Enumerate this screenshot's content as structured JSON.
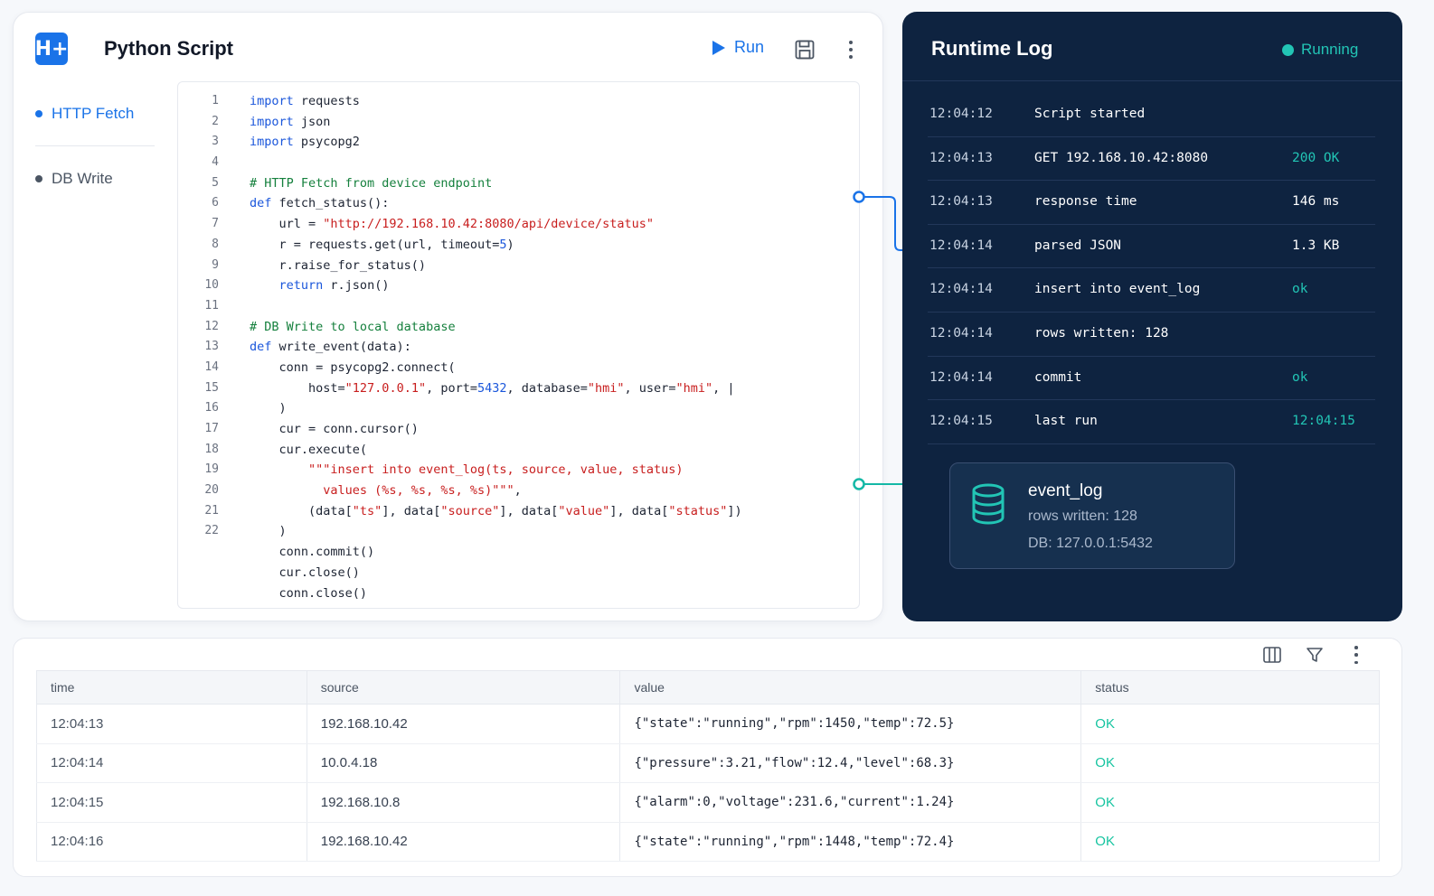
{
  "editor": {
    "logo_text": "H+",
    "title": "Python Script",
    "run_label": "Run",
    "save_icon": "save-icon",
    "more_icon": "more-vertical-icon",
    "nav": [
      {
        "label": "HTTP Fetch",
        "active": true
      },
      {
        "label": "DB Write",
        "active": false
      }
    ],
    "code_lines": [
      {
        "n": "1",
        "html": "<span class='kw'>import</span> requests"
      },
      {
        "n": "2",
        "html": "<span class='kw'>import</span> json"
      },
      {
        "n": "3",
        "html": "<span class='kw'>import</span> psycopg2"
      },
      {
        "n": "4",
        "html": ""
      },
      {
        "n": "5",
        "html": "<span class='cm'># HTTP Fetch from device endpoint</span>"
      },
      {
        "n": "6",
        "html": "<span class='kw'>def</span> fetch_status():"
      },
      {
        "n": "7",
        "html": "    url = <span class='st'>\"http://192.168.10.42:8080/api/device/status\"</span>"
      },
      {
        "n": "8",
        "html": "    r = requests.get(url, timeout=<span class='nm'>5</span>)"
      },
      {
        "n": "9",
        "html": "    r.raise_for_status()"
      },
      {
        "n": "10",
        "html": "    <span class='kw'>return</span> r.json()"
      },
      {
        "n": "11",
        "html": ""
      },
      {
        "n": "12",
        "html": "<span class='cm'># DB Write to local database</span>"
      },
      {
        "n": "13",
        "html": "<span class='kw'>def</span> write_event(data):"
      },
      {
        "n": "14",
        "html": "    conn = psycopg2.connect("
      },
      {
        "n": "15",
        "html": "        host=<span class='st'>\"127.0.0.1\"</span>, port=<span class='nm'>5432</span>, database=<span class='st'>\"hmi\"</span>, user=<span class='st'>\"hmi\"</span>, |"
      },
      {
        "n": "16",
        "html": "    )"
      },
      {
        "n": "17",
        "html": "    cur = conn.cursor()"
      },
      {
        "n": "18",
        "html": "    cur.execute("
      },
      {
        "n": "19",
        "html": "        <span class='st'>\"\"\"insert into event_log(ts, source, value, status)</span>"
      },
      {
        "n": "20",
        "html": "<span class='st'>          values (%s, %s, %s, %s)\"\"\"</span>,"
      },
      {
        "n": "21",
        "html": "        (data[<span class='st'>\"ts\"</span>], data[<span class='st'>\"source\"</span>], data[<span class='st'>\"value\"</span>], data[<span class='st'>\"status\"</span>])"
      },
      {
        "n": "22",
        "html": "    )"
      },
      {
        "n": "",
        "html": "    conn.commit()"
      },
      {
        "n": "",
        "html": "    cur.close()"
      },
      {
        "n": "",
        "html": "    conn.close()"
      }
    ]
  },
  "log": {
    "title": "Runtime Log",
    "status": "Running",
    "rows": [
      {
        "time": "12:04:12",
        "msg": "Script started",
        "value": "",
        "accent": false
      },
      {
        "time": "12:04:13",
        "msg": "GET 192.168.10.42:8080",
        "value": "200 OK",
        "accent": true
      },
      {
        "time": "12:04:13",
        "msg": "response time",
        "value": "146 ms",
        "accent": false
      },
      {
        "time": "12:04:14",
        "msg": "parsed JSON",
        "value": "1.3 KB",
        "accent": false
      },
      {
        "time": "12:04:14",
        "msg": "insert into event_log",
        "value": "ok",
        "accent": true
      },
      {
        "time": "12:04:14",
        "msg": "rows written: 128",
        "value": "",
        "accent": false
      },
      {
        "time": "12:04:14",
        "msg": "commit",
        "value": "ok",
        "accent": true
      },
      {
        "time": "12:04:15",
        "msg": "last run",
        "value": "12:04:15",
        "accent": true
      }
    ],
    "db": {
      "name": "event_log",
      "rows": "rows written: 128",
      "addr": "DB: 127.0.0.1:5432"
    }
  },
  "table": {
    "columns": [
      "time",
      "source",
      "value",
      "status"
    ],
    "rows": [
      {
        "time": "12:04:13",
        "source": "192.168.10.42",
        "value": "{\"state\":\"running\",\"rpm\":1450,\"temp\":72.5}",
        "status": "OK"
      },
      {
        "time": "12:04:14",
        "source": "10.0.4.18",
        "value": "{\"pressure\":3.21,\"flow\":12.4,\"level\":68.3}",
        "status": "OK"
      },
      {
        "time": "12:04:15",
        "source": "192.168.10.8",
        "value": "{\"alarm\":0,\"voltage\":231.6,\"current\":1.24}",
        "status": "OK"
      },
      {
        "time": "12:04:16",
        "source": "192.168.10.42",
        "value": "{\"state\":\"running\",\"rpm\":1448,\"temp\":72.4}",
        "status": "OK"
      }
    ]
  },
  "colors": {
    "accent": "#1a73e8",
    "log_bg": "#0e2340",
    "ok": "#16c4a0"
  }
}
